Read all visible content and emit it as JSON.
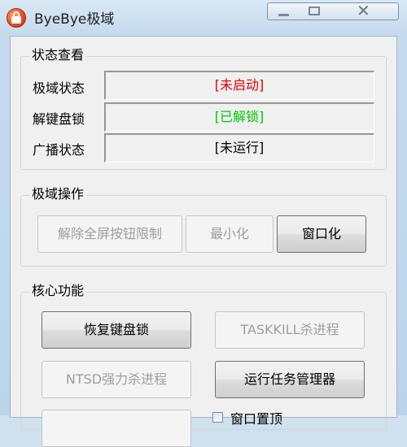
{
  "window": {
    "title": "ByeBye极域",
    "close_glyph": "✕"
  },
  "status_group": {
    "title": "状态查看",
    "rows": [
      {
        "label": "极域状态",
        "value": "[未启动]",
        "color": "#e60000"
      },
      {
        "label": "解键盘锁",
        "value": "[已解锁]",
        "color": "#00c800"
      },
      {
        "label": "广播状态",
        "value": "[未运行]",
        "color": "#000000"
      }
    ]
  },
  "ops_group": {
    "title": "极域操作",
    "unlock_fullscreen": "解除全屏按钮限制",
    "minimize": "最小化",
    "windowed": "窗口化"
  },
  "core_group": {
    "title": "核心功能",
    "restore_keyboard": "恢复键盘锁",
    "taskkill": "TASKKILL杀进程",
    "ntsd": "NTSD强力杀进程",
    "task_manager": "运行任务管理器",
    "pin_window": "窗口置顶"
  }
}
